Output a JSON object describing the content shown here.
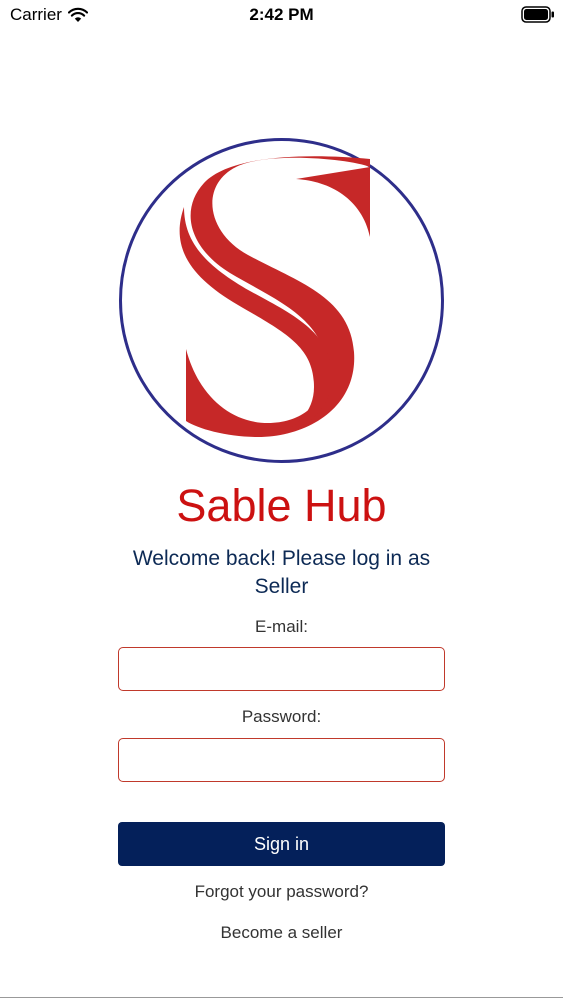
{
  "status_bar": {
    "carrier": "Carrier",
    "time": "2:42 PM",
    "wifi_icon": "wifi-icon",
    "battery_icon": "battery-icon"
  },
  "brand": {
    "name": "Sable Hub",
    "logo_icon": "sable-hub-logo",
    "color": "#cc1111",
    "circle_color": "#2e2e8a"
  },
  "login": {
    "welcome": "Welcome back! Please log in as Seller",
    "email_label": "E-mail:",
    "email_value": "",
    "password_label": "Password:",
    "password_value": "",
    "signin_label": "Sign in",
    "forgot_label": "Forgot your password?",
    "become_seller_label": "Become a seller",
    "input_border_color": "#c0392b",
    "button_color": "#04205a"
  }
}
